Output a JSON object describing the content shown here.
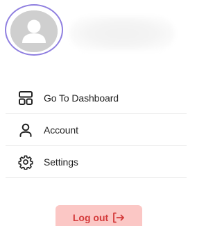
{
  "profile": {
    "avatar_icon": "user-avatar-icon",
    "ring_color": "#8f7fe0",
    "avatar_bg": "#cfcfcf"
  },
  "menu": {
    "items": [
      {
        "label": "Go To Dashboard",
        "icon": "dashboard-icon"
      },
      {
        "label": "Account",
        "icon": "user-icon"
      },
      {
        "label": "Settings",
        "icon": "gear-icon"
      }
    ]
  },
  "logout": {
    "label": "Log out",
    "icon": "logout-arrow-icon",
    "bg_color": "#fbc7c5",
    "text_color": "#d43a3a"
  }
}
